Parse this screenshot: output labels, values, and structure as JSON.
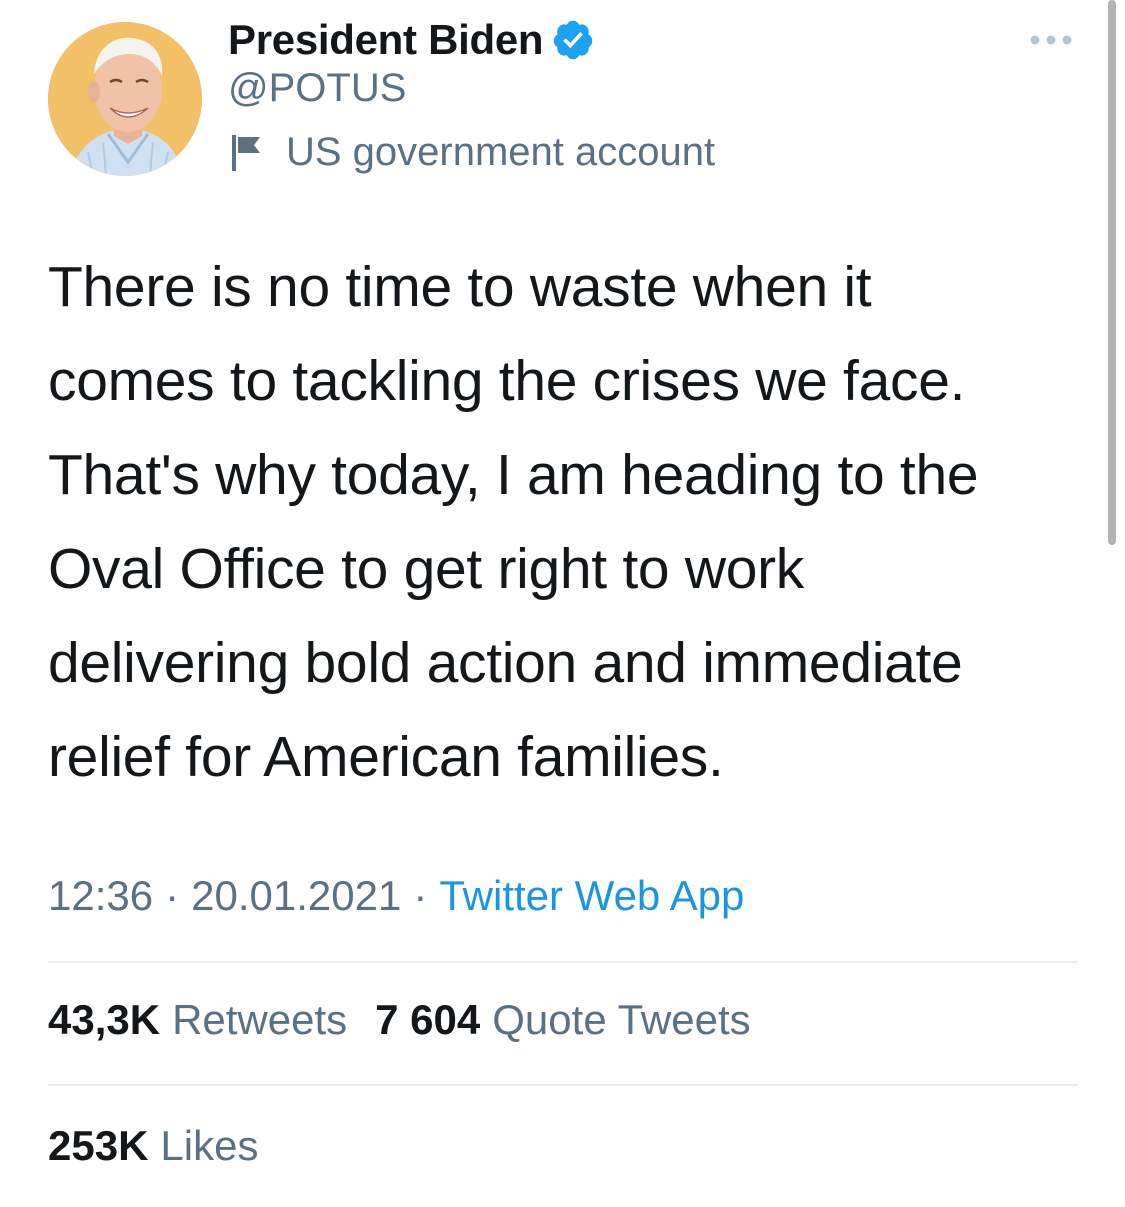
{
  "author": {
    "display_name": "President Biden",
    "handle": "@POTUS",
    "label": "US government account",
    "avatar_icon": "profile-photo",
    "verified_icon": "verified-badge-icon",
    "label_icon": "flag-icon"
  },
  "tweet": {
    "text": "There is no time to waste when it\ncomes to tackling the crises we face.\nThat's why today, I am heading to the\nOval Office to get right to work\ndelivering bold action and immediate\nrelief for American families.",
    "time": "12:36",
    "separator": "·",
    "date": "20.01.2021",
    "source": "Twitter Web App"
  },
  "stats": {
    "retweets_value": "43,3K",
    "retweets_label": "Retweets",
    "quotes_value": "7 604",
    "quotes_label": "Quote Tweets",
    "likes_value": "253K",
    "likes_label": "Likes"
  },
  "colors": {
    "text_primary": "#14171a",
    "text_secondary": "#5b7083",
    "link": "#1b95e0",
    "verified": "#1da1f2",
    "divider": "#e6ecf0",
    "avatar_background": "#f1c067"
  }
}
